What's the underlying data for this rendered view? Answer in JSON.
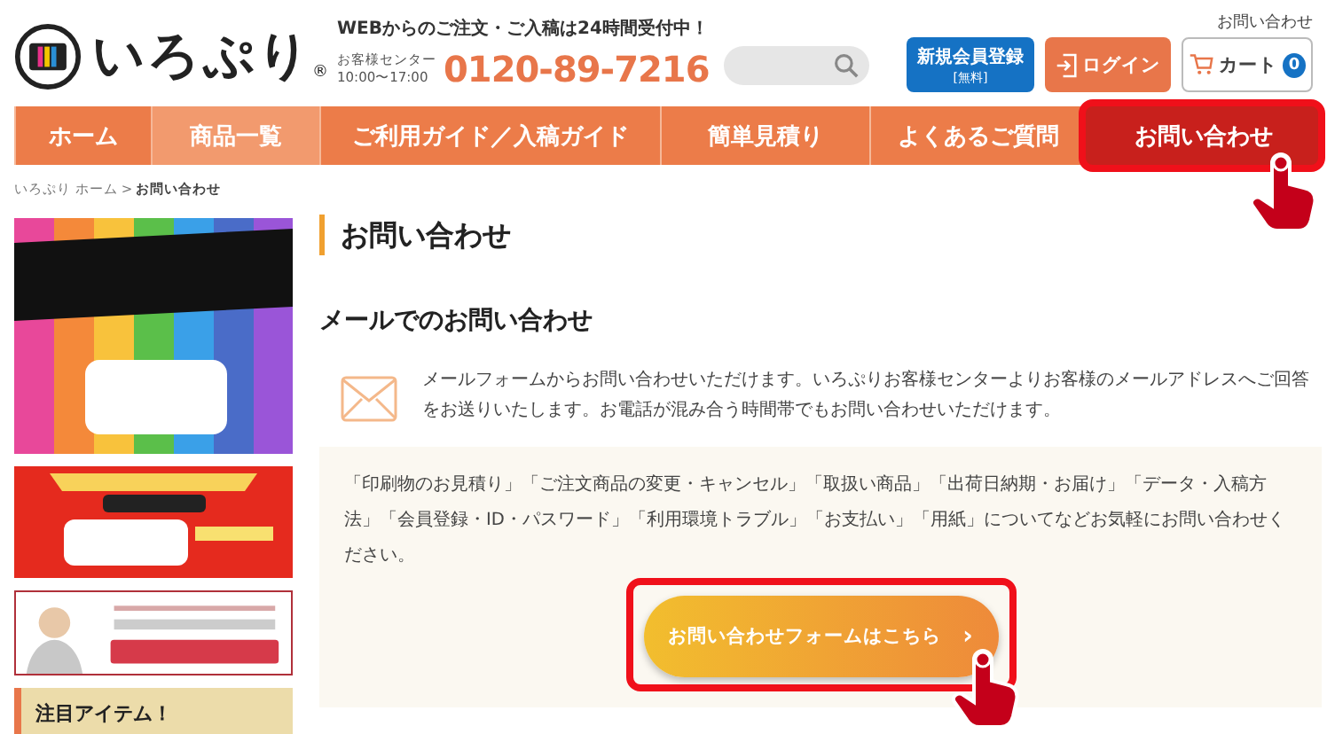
{
  "header": {
    "logo_text": "いろぷり",
    "logo_mark": "®",
    "notice": "WEBからのご注文・ご入稿は24時間受付中！",
    "center_label": "お客様センター",
    "hours": "10:00〜17:00",
    "phone": "0120-89-7216",
    "top_link": "お問い合わせ",
    "register_button": {
      "label": "新規会員登録",
      "sub": "[無料]"
    },
    "login_button": "ログイン",
    "cart": {
      "label": "カート",
      "count": "0"
    }
  },
  "nav": [
    {
      "label": "ホーム",
      "selected": false,
      "hovered": false,
      "highlighted": false
    },
    {
      "label": "商品一覧",
      "selected": false,
      "hovered": true,
      "highlighted": false
    },
    {
      "label": "ご利用ガイド／入稿ガイド",
      "selected": false,
      "hovered": false,
      "highlighted": false
    },
    {
      "label": "簡単見積り",
      "selected": false,
      "hovered": false,
      "highlighted": false
    },
    {
      "label": "よくあるご質問",
      "selected": false,
      "hovered": false,
      "highlighted": false
    },
    {
      "label": "お問い合わせ",
      "selected": true,
      "hovered": false,
      "highlighted": true
    }
  ],
  "breadcrumb": {
    "home": "いろぷり ホーム",
    "separator": ">",
    "current": "お問い合わせ"
  },
  "sidebar": {
    "section_title": "注目アイテム！"
  },
  "main": {
    "title": "お問い合わせ",
    "subtitle": "メールでのお問い合わせ",
    "intro": "メールフォームからお問い合わせいただけます。いろぷりお客様センターよりお客様のメールアドレスへご回答をお送りいたします。お電話が混み合う時間帯でもお問い合わせいただけます。",
    "notice": "「印刷物のお見積り」「ご注文商品の変更・キャンセル」「取扱い商品」「出荷日納期・お届け」「データ・入稿方法」「会員登録・ID・パスワード」「利用環境トラブル」「お支払い」「用紙」についてなどお気軽にお問い合わせください。",
    "form_button": {
      "label": "お問い合わせフォームはこちら",
      "arrow": "›",
      "highlighted": true
    }
  }
}
